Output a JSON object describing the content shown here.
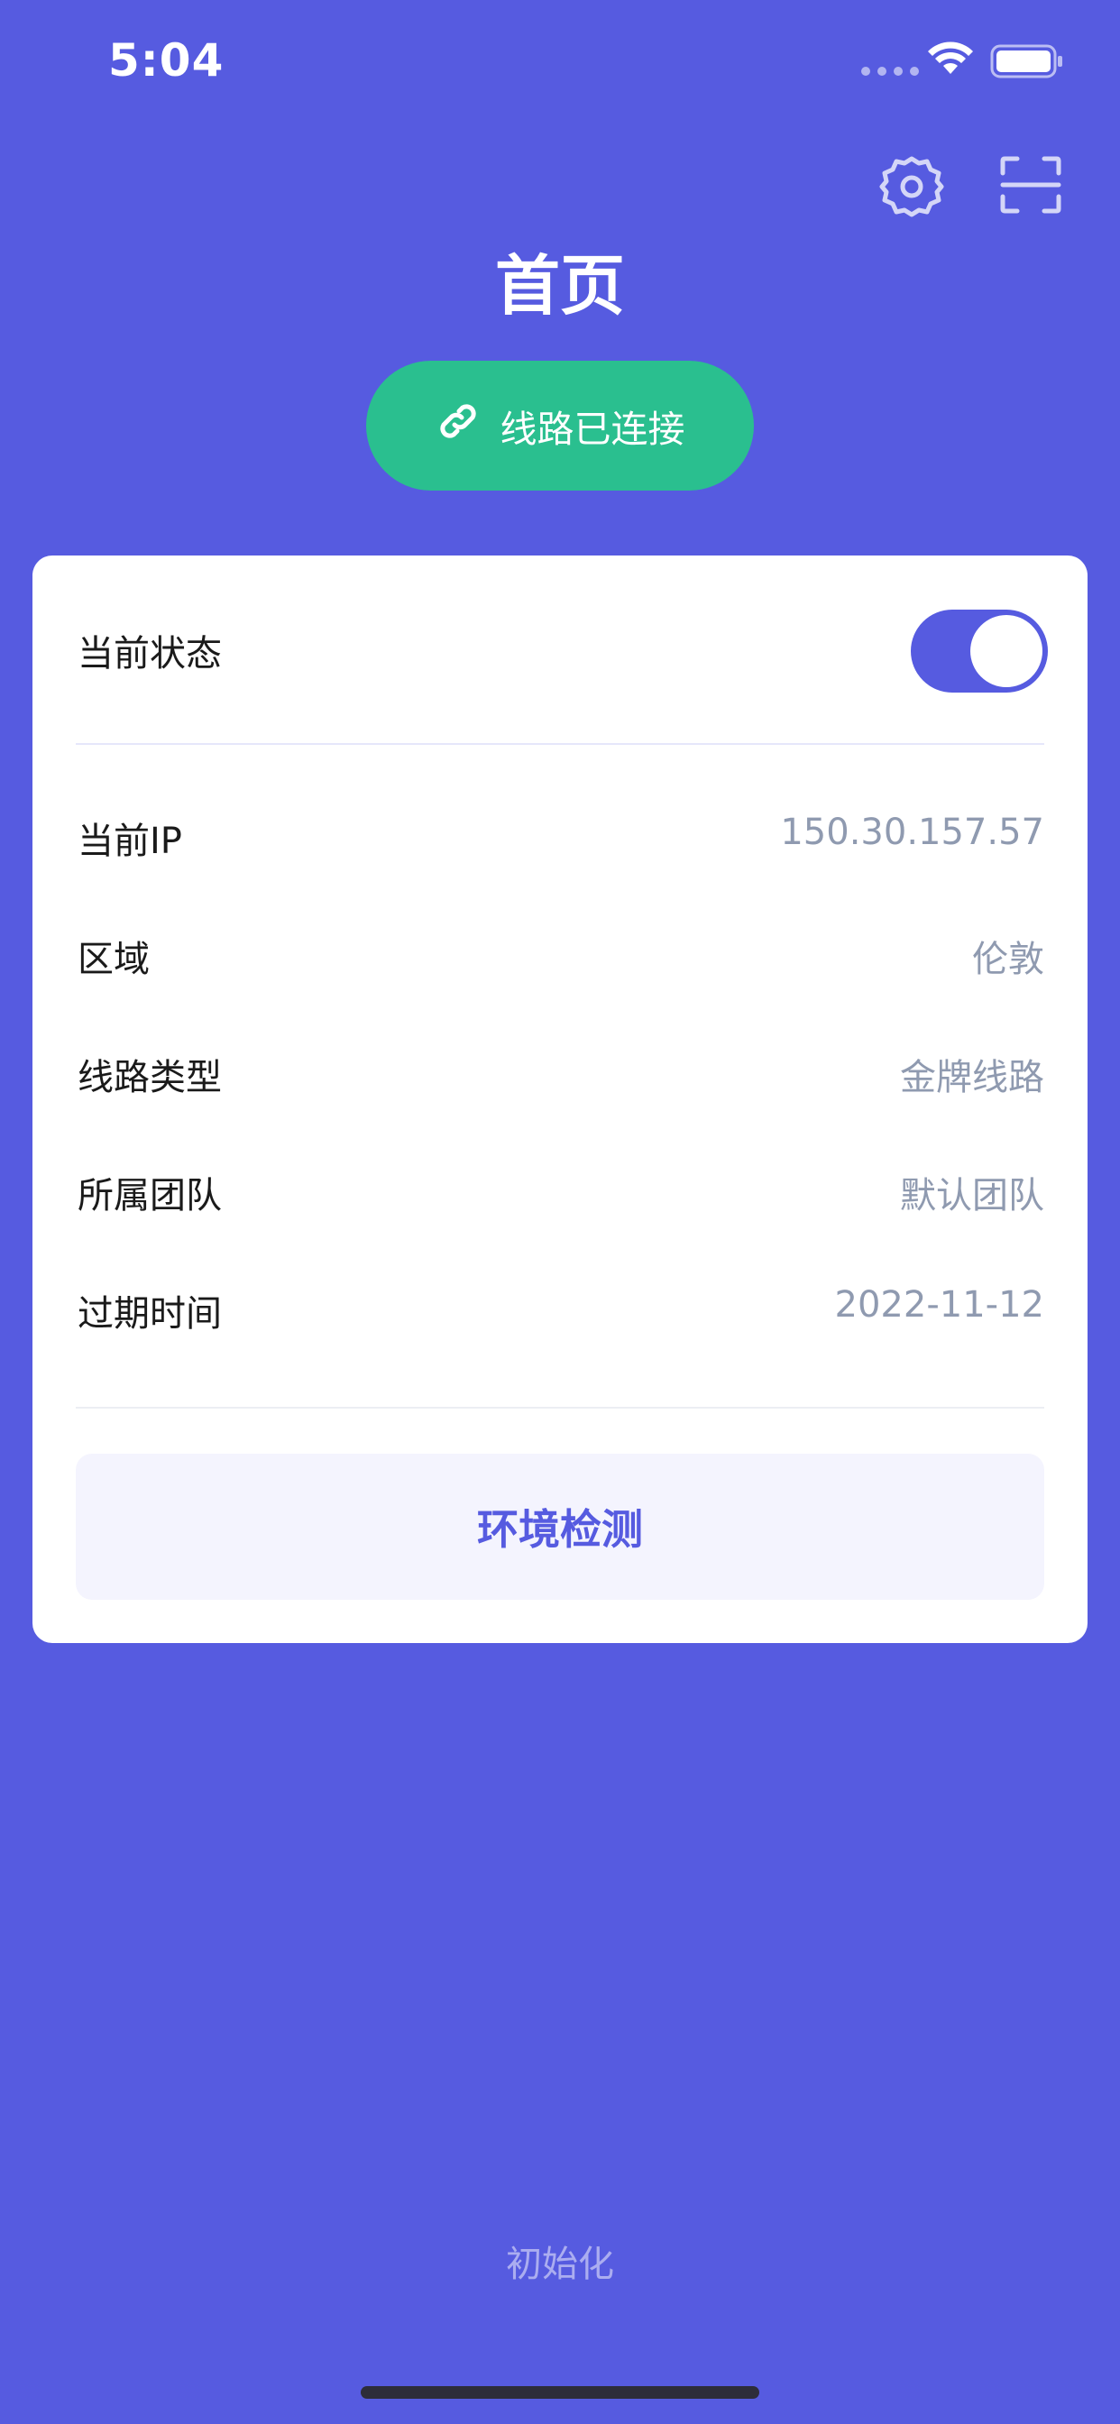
{
  "status_bar": {
    "time": "5:04"
  },
  "header": {
    "title": "首页",
    "icons": {
      "settings": "gear-icon",
      "scan": "scan-icon"
    }
  },
  "connection": {
    "label": "线路已连接",
    "icon": "link-icon",
    "color": "#2abf8f"
  },
  "card": {
    "status_label": "当前状态",
    "status_on": true,
    "rows": [
      {
        "label": "当前IP",
        "value": "150.30.157.57"
      },
      {
        "label": "区域",
        "value": "伦敦"
      },
      {
        "label": "线路类型",
        "value": "金牌线路"
      },
      {
        "label": "所属团队",
        "value": "默认团队"
      },
      {
        "label": "过期时间",
        "value": "2022-11-12"
      }
    ],
    "env_button": "环境检测"
  },
  "footer": {
    "init_label": "初始化"
  },
  "colors": {
    "background": "#565be0",
    "accent": "#565be0",
    "value_text": "#8f9ab0"
  }
}
